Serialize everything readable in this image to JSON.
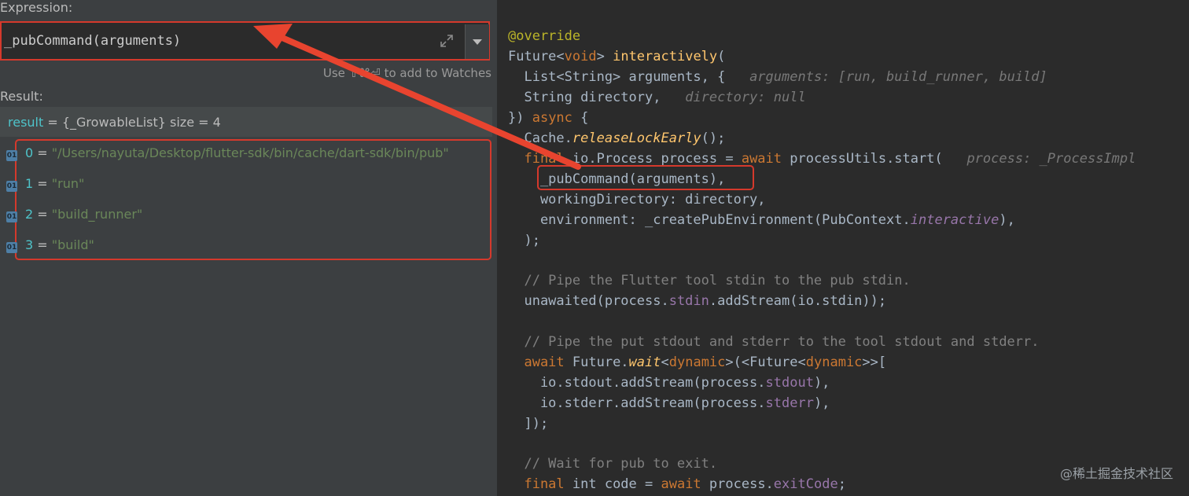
{
  "evaluate": {
    "expression_label": "Expression:",
    "expression_value": "_pubCommand(arguments)",
    "watch_hint": "Use ⇧⌘⏎ to add to Watches",
    "result_label": "Result:",
    "result_name": "result",
    "result_summary": " = {_GrowableList} size = 4",
    "items": [
      {
        "index": "0",
        "value": "\"/Users/nayuta/Desktop/flutter-sdk/bin/cache/dart-sdk/bin/pub\""
      },
      {
        "index": "1",
        "value": "\"run\""
      },
      {
        "index": "2",
        "value": "\"build_runner\""
      },
      {
        "index": "3",
        "value": "\"build\""
      }
    ],
    "badge_label": "01"
  },
  "code": {
    "l0": "@override",
    "l1a": "Future<",
    "l1b": "void",
    "l1c": "> ",
    "l1d": "interactively",
    "l1e": "(",
    "l2a": "  List<String> arguments, {",
    "l2hint": "arguments: [run, build_runner, build]",
    "l3a": "  String directory,",
    "l3hint": "directory: null",
    "l4a": "}) ",
    "l4b": "async",
    "l4c": " {",
    "l5a": "  Cache.",
    "l5b": "releaseLockEarly",
    "l5c": "();",
    "l6a": "  final",
    "l6b": " io.Process process = ",
    "l6c": "await",
    "l6d": " processUtils.start(",
    "l6hint": "process: _ProcessImpl",
    "l7a": "    _pubCommand(arguments),",
    "l8a": "    workingDirectory: directory,",
    "l9a": "    environment: _createPubEnvironment(PubContext.",
    "l9b": "interactive",
    "l9c": "),",
    "l10a": "  );",
    "l12": "  // Pipe the Flutter tool stdin to the pub stdin.",
    "l13a": "  unawaited(process.",
    "l13b": "stdin",
    "l13c": ".addStream(io.stdin));",
    "l15": "  // Pipe the put stdout and stderr to the tool stdout and stderr.",
    "l16a": "  await",
    "l16b": " Future.",
    "l16c": "wait",
    "l16d": "<",
    "l16e": "dynamic",
    "l16f": ">(<Future<",
    "l16g": "dynamic",
    "l16h": ">>[",
    "l17a": "    io.stdout.addStream(process.",
    "l17b": "stdout",
    "l17c": "),",
    "l18a": "    io.stderr.addStream(process.",
    "l18b": "stderr",
    "l18c": "),",
    "l19a": "  ]);",
    "l21": "  // Wait for pub to exit.",
    "l22a": "  final",
    "l22b": " int code = ",
    "l22c": "await",
    "l22d": " process.",
    "l22e": "exitCode",
    "l22f": ";"
  },
  "watermark": "@稀土掘金技术社区",
  "colors": {
    "annotation_red": "#d5392c",
    "selection_blue": "#2d5a8c"
  }
}
